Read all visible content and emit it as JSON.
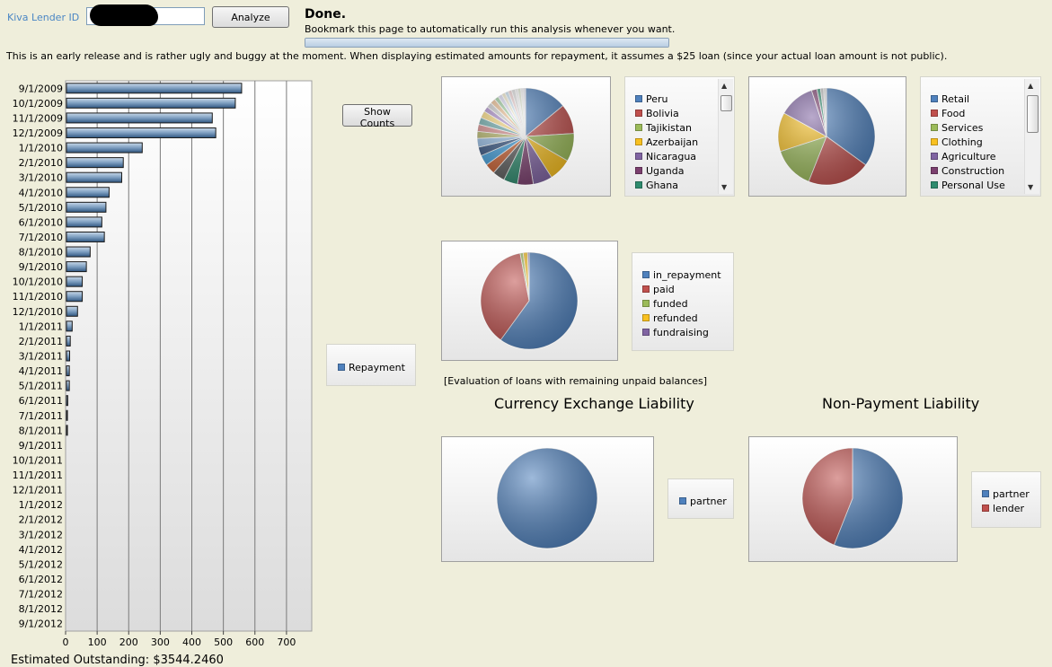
{
  "header": {
    "lender_label": "Kiva Lender ID",
    "lender_value": "",
    "analyze_label": "Analyze",
    "status": "Done.",
    "bookmark_text": "Bookmark this page to automatically run this analysis whenever you want.",
    "progress": 1.0,
    "notice": "This is an early release and is rather ugly and buggy at the moment. When displaying estimated amounts for repayment, it assumes a $25 loan (since your actual loan amount is not public)."
  },
  "controls": {
    "show_counts_label": "Show Counts"
  },
  "chart_data": [
    {
      "type": "bar",
      "orientation": "horizontal",
      "categories": [
        "9/1/2009",
        "10/1/2009",
        "11/1/2009",
        "12/1/2009",
        "1/1/2010",
        "2/1/2010",
        "3/1/2010",
        "4/1/2010",
        "5/1/2010",
        "6/1/2010",
        "7/1/2010",
        "8/1/2010",
        "9/1/2010",
        "10/1/2010",
        "11/1/2010",
        "12/1/2010",
        "1/1/2011",
        "2/1/2011",
        "3/1/2011",
        "4/1/2011",
        "5/1/2011",
        "6/1/2011",
        "7/1/2011",
        "8/1/2011",
        "9/1/2011",
        "10/1/2011",
        "11/1/2011",
        "12/1/2011",
        "1/1/2012",
        "2/1/2012",
        "3/1/2012",
        "4/1/2012",
        "5/1/2012",
        "6/1/2012",
        "7/1/2012",
        "8/1/2012",
        "9/1/2012"
      ],
      "series": [
        {
          "name": "Repayment",
          "values": [
            555,
            535,
            462,
            473,
            240,
            180,
            175,
            135,
            125,
            112,
            120,
            75,
            63,
            50,
            50,
            35,
            18,
            12,
            10,
            9,
            9,
            4,
            3,
            3,
            0,
            0,
            0,
            0,
            0,
            0,
            0,
            0,
            0,
            0,
            0,
            0,
            0
          ]
        }
      ],
      "xlim": [
        0,
        780
      ],
      "xticks": [
        0,
        100,
        200,
        300,
        400,
        500,
        600,
        700
      ],
      "legend": "right",
      "grid": true
    },
    {
      "type": "pie",
      "slices": [
        {
          "label": "Peru",
          "value": 12,
          "color": "#4f81bd"
        },
        {
          "label": "Bolivia",
          "value": 8.5,
          "color": "#c0504d"
        },
        {
          "label": "Tajikistan",
          "value": 8,
          "color": "#9bbb59"
        },
        {
          "label": "Azerbaijan",
          "value": 6.5,
          "color": "#f8c020"
        },
        {
          "label": "Nicaragua",
          "value": 5.5,
          "color": "#8064a2"
        },
        {
          "label": "Uganda",
          "value": 4.5,
          "color": "#7b3f6e"
        },
        {
          "label": "Ghana",
          "value": 4,
          "color": "#2e8b6e"
        },
        {
          "label": "",
          "value": 3.5,
          "color": "#5a5a5a"
        },
        {
          "label": "",
          "value": 3,
          "color": "#c85c2c"
        },
        {
          "label": "",
          "value": 3,
          "color": "#3a9ad9"
        },
        {
          "label": "",
          "value": 2.5,
          "color": "#2a4a7a"
        },
        {
          "label": "",
          "value": 2.5,
          "color": "#8eb6e0"
        },
        {
          "label": "",
          "value": 2,
          "color": "#b0b060"
        },
        {
          "label": "",
          "value": 2,
          "color": "#d08080"
        },
        {
          "label": "",
          "value": 2,
          "color": "#60a0a0"
        },
        {
          "label": "",
          "value": 2,
          "color": "#f0d070"
        },
        {
          "label": "",
          "value": 1.5,
          "color": "#a080c0"
        },
        {
          "label": "",
          "value": 1.5,
          "color": "#c0c0c0"
        },
        {
          "label": "",
          "value": 1.5,
          "color": "#e0b080"
        },
        {
          "label": "",
          "value": 1.2,
          "color": "#90c090"
        },
        {
          "label": "",
          "value": 1.2,
          "color": "#d0d0e8"
        },
        {
          "label": "",
          "value": 1,
          "color": "#e8e0c0"
        },
        {
          "label": "",
          "value": 1,
          "color": "#c0d8e8"
        },
        {
          "label": "",
          "value": 1,
          "color": "#e8c8c8"
        },
        {
          "label": "",
          "value": 1,
          "color": "#d8d8d8"
        },
        {
          "label": "",
          "value": 0.8,
          "color": "#f0f0f0"
        },
        {
          "label": "",
          "value": 0.8,
          "color": "#e0e8d0"
        },
        {
          "label": "",
          "value": 0.7,
          "color": "#f4f4f4"
        },
        {
          "label": "",
          "value": 0.7,
          "color": "#e8e8f4"
        }
      ],
      "legend": "right"
    },
    {
      "type": "pie",
      "slices": [
        {
          "label": "Retail",
          "value": 35,
          "color": "#4f81bd"
        },
        {
          "label": "Food",
          "value": 21,
          "color": "#c0504d"
        },
        {
          "label": "Services",
          "value": 14,
          "color": "#9bbb59"
        },
        {
          "label": "Clothing",
          "value": 13,
          "color": "#f8c020"
        },
        {
          "label": "Agriculture",
          "value": 12,
          "color": "#8064a2"
        },
        {
          "label": "Construction",
          "value": 1.8,
          "color": "#7b3f6e"
        },
        {
          "label": "Personal Use",
          "value": 1.2,
          "color": "#2e8b6e"
        },
        {
          "label": "",
          "value": 1,
          "color": "#c0c0c0"
        },
        {
          "label": "",
          "value": 1,
          "color": "#e0e0e0"
        }
      ],
      "legend": "right"
    },
    {
      "type": "pie",
      "slices": [
        {
          "label": "in_repayment",
          "value": 60,
          "color": "#4f81bd"
        },
        {
          "label": "paid",
          "value": 37,
          "color": "#c0504d"
        },
        {
          "label": "funded",
          "value": 1,
          "color": "#9bbb59"
        },
        {
          "label": "refunded",
          "value": 1.5,
          "color": "#f8c020"
        },
        {
          "label": "fundraising",
          "value": 0.5,
          "color": "#8064a2"
        }
      ],
      "legend": "right"
    },
    {
      "type": "pie",
      "title": "Currency Exchange Liability",
      "slices": [
        {
          "label": "partner",
          "value": 100,
          "color": "#4f81bd"
        }
      ],
      "legend": "right"
    },
    {
      "type": "pie",
      "title": "Non-Payment Liability",
      "slices": [
        {
          "label": "partner",
          "value": 56,
          "color": "#4f81bd"
        },
        {
          "label": "lender",
          "value": 44,
          "color": "#c0504d"
        }
      ],
      "legend": "right"
    }
  ],
  "repayment_legend": {
    "label": "Repayment",
    "color": "#4f81bd"
  },
  "evaluation_text": "[Evaluation of loans with remaining unpaid balances]",
  "currency_title": "Currency Exchange Liability",
  "nonpayment_title": "Non-Payment Liability",
  "estimated_text": "Estimated Outstanding: $3544.2460"
}
